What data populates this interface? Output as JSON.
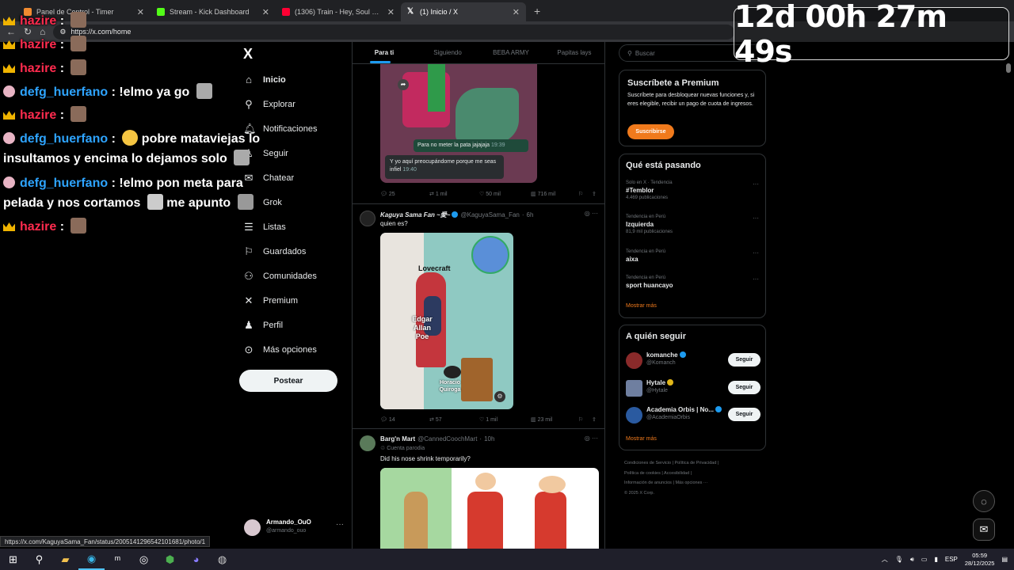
{
  "browser": {
    "tabs": [
      {
        "title": "Panel de Control - Timer",
        "color": "#f28b30"
      },
      {
        "title": "Stream - Kick Dashboard",
        "color": "#53fc18"
      },
      {
        "title": "(1306) Train - Hey, Soul Siste",
        "color": "#ff0033"
      },
      {
        "title": "(1) Inicio / X",
        "color": "#ffffff"
      }
    ],
    "url": "https://x.com/home",
    "new_tab": "+"
  },
  "chat": [
    {
      "user": "hazire",
      "badge": "crown",
      "text": ""
    },
    {
      "user": "hazire",
      "badge": "crown",
      "text": ""
    },
    {
      "user": "defg_huerfano",
      "badge": "skull",
      "text": "!elmo ya go"
    },
    {
      "user": "hazire",
      "badge": "crown",
      "text": ""
    },
    {
      "user": "defg_huerfano",
      "badge": "skull",
      "text": "pobre mataviejas lo",
      "text2": "insultamos y encima lo dejamos solo"
    },
    {
      "user": "defg_huerfano",
      "badge": "skull",
      "text": "!elmo pon meta para",
      "text2": "pelada y nos cortamos",
      "text3": "me apunto"
    },
    {
      "user": "hazire",
      "badge": "crown",
      "text": ""
    }
  ],
  "timer": "12d 00h 27m 49s",
  "nav": {
    "logo": "X",
    "items": [
      "Inicio",
      "Explorar",
      "Notificaciones",
      "Seguir",
      "Chatear",
      "Grok",
      "Listas",
      "Guardados",
      "Comunidades",
      "Premium",
      "Perfil",
      "Más opciones"
    ],
    "post_button": "Postear",
    "account": {
      "name": "Armando_OuO",
      "handle": "@armando_ouo"
    }
  },
  "timeline": {
    "tabs": [
      "Para ti",
      "Siguiendo",
      "BEBA ARMY",
      "Papitas lays"
    ],
    "post1": {
      "caption1": "Para no meter la pata jajajaja",
      "time1": "19:39",
      "caption2": "Y yo aquí preocupándome porque me seas infiel",
      "time2": "19:40",
      "actions": [
        "25",
        "1 mil",
        "50 mil",
        "716 mil"
      ]
    },
    "post2": {
      "name": "Kaguya Sama Fan ~愛~",
      "handle": "@KaguyaSama_Fan",
      "time": "6h",
      "text": "quien es?",
      "labels": [
        "Lovecraft",
        "Edgar Allan Poe",
        "Horacio Quiroga"
      ],
      "actions": [
        "14",
        "57",
        "1 mil",
        "23 mil"
      ]
    },
    "post3": {
      "name": "Barg'n Mart",
      "handle": "@CannedCoochMart",
      "time": "10h",
      "parody": "Cuenta parodia",
      "text": "Did his nose shrink temporarily?"
    }
  },
  "right": {
    "search_placeholder": "Buscar",
    "premium": {
      "title": "Suscríbete a Premium",
      "body": "Suscríbete para desbloquear nuevas funciones y, si eres elegible, recibir un pago de cuota de ingresos.",
      "button": "Suscribirse"
    },
    "trends_title": "Qué está pasando",
    "trends": [
      {
        "context": "Solo en X · Tendencia",
        "name": "#Temblor",
        "posts": "4.469 publicaciones"
      },
      {
        "context": "Tendencia en Perú",
        "name": "Izquierda",
        "posts": "81,9 mil publicaciones"
      },
      {
        "context": "Tendencia en Perú",
        "name": "aixa",
        "posts": ""
      },
      {
        "context": "Tendencia en Perú",
        "name": "sport huancayo",
        "posts": ""
      }
    ],
    "show_more": "Mostrar más",
    "who_title": "A quién seguir",
    "who": [
      {
        "name": "komanche",
        "handle": "@Komanch",
        "btn": "Seguir"
      },
      {
        "name": "Hytale",
        "handle": "@Hytale",
        "btn": "Seguir"
      },
      {
        "name": "Academia Orbis | No...",
        "handle": "@AcademiaOrbis",
        "btn": "Seguir"
      }
    ],
    "footer": [
      "Condiciones de Servicio",
      "Política de Privacidad",
      "Política de cookies",
      "Accesibilidad",
      "Información de anuncios",
      "Más opciones ···",
      "© 2025 X Corp."
    ]
  },
  "status_url": "https://x.com/KaguyaSama_Fan/status/2005141296542101681/photo/1",
  "taskbar": {
    "lang": "ESP",
    "time": "05:59",
    "date": "28/12/2025"
  }
}
